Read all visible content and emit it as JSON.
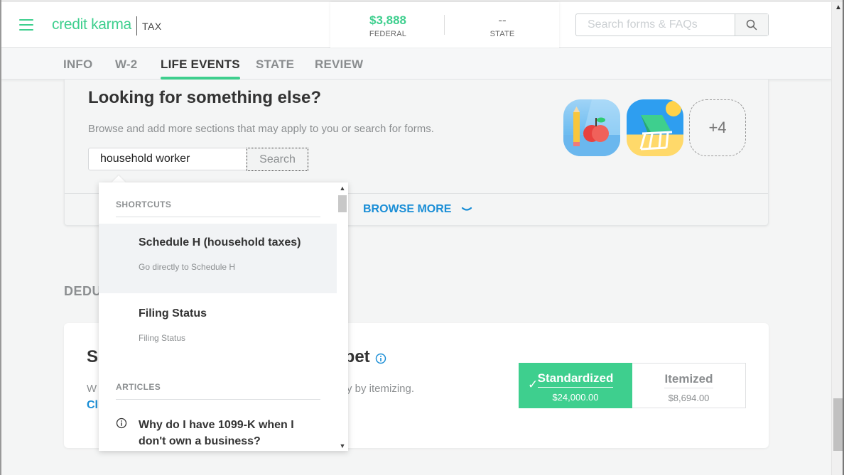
{
  "header": {
    "logo_text": "credit karma",
    "logo_product": "TAX",
    "refund": {
      "federal_amount": "$3,888",
      "federal_label": "FEDERAL",
      "state_amount": "--",
      "state_label": "STATE"
    },
    "search": {
      "placeholder": "Search forms & FAQs",
      "value": ""
    }
  },
  "nav": {
    "tabs": [
      {
        "label": "INFO",
        "active": false
      },
      {
        "label": "W-2",
        "active": false
      },
      {
        "label": "LIFE EVENTS",
        "active": true
      },
      {
        "label": "STATE",
        "active": false
      },
      {
        "label": "REVIEW",
        "active": false
      }
    ]
  },
  "looking": {
    "title": "Looking for something else?",
    "description": "Browse and add more sections that may apply to you or search for forms.",
    "search_value": "household worker",
    "search_button": "Search",
    "browse_more": "BROWSE MORE",
    "icons": [
      "education-icon",
      "vacation-icon"
    ],
    "more_count": "+4"
  },
  "dropdown": {
    "shortcuts_label": "SHORTCUTS",
    "shortcuts": [
      {
        "title": "Schedule H (household taxes)",
        "subtitle": "Go directly to Schedule H",
        "highlighted": true
      },
      {
        "title": "Filing Status",
        "subtitle": "Filing Status",
        "highlighted": false
      }
    ],
    "articles_label": "ARTICLES",
    "articles": [
      {
        "title": "Why do I have 1099-K when I don't own a business?"
      }
    ]
  },
  "deductions": {
    "section_label_visible": "DEDU",
    "title_start": "S",
    "title_end": "t bet",
    "desc_start": "W",
    "desc_end": "y by itemizing.",
    "link_start": "Cl",
    "options": [
      {
        "label": "Standardized",
        "amount": "$24,000.00",
        "selected": true
      },
      {
        "label": "Itemized",
        "amount": "$8,694.00",
        "selected": false
      }
    ]
  },
  "colors": {
    "brand_green": "#3ecf8e",
    "link_blue": "#1a8ed6"
  }
}
